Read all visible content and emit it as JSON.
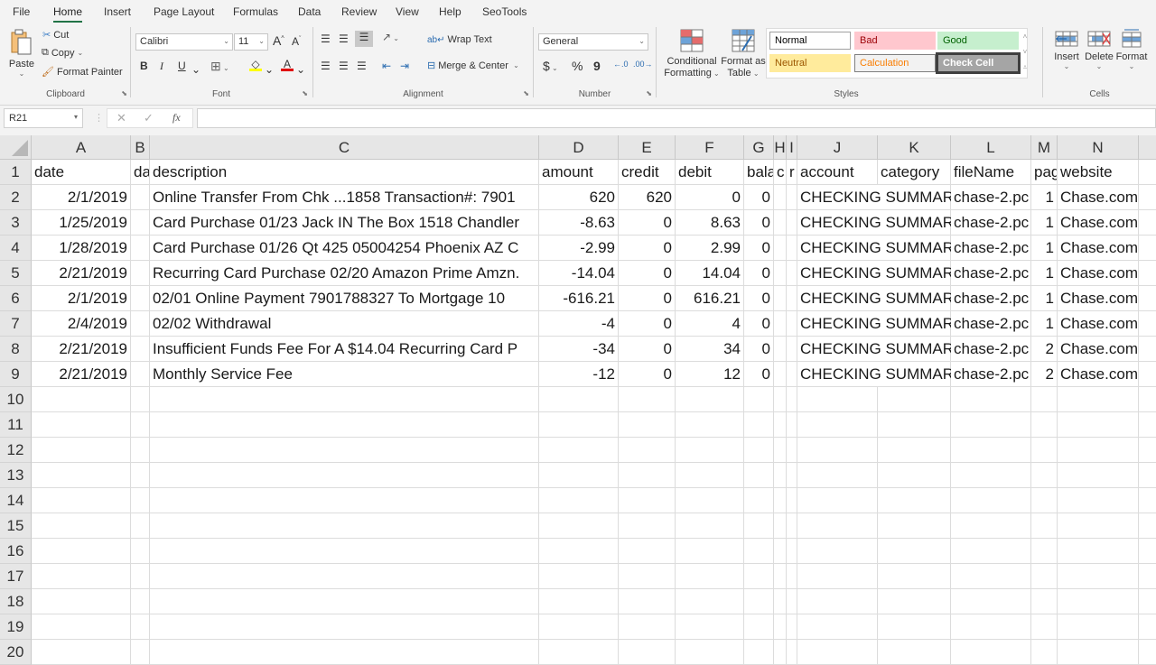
{
  "ribbon": {
    "tabs": [
      "File",
      "Home",
      "Insert",
      "Page Layout",
      "Formulas",
      "Data",
      "Review",
      "View",
      "Help",
      "SeoTools"
    ],
    "active_tab": "Home",
    "clipboard": {
      "paste": "Paste",
      "cut": "Cut",
      "copy": "Copy",
      "format_painter": "Format Painter",
      "label": "Clipboard"
    },
    "font": {
      "name": "Calibri",
      "size": "11",
      "label": "Font",
      "bold": "B",
      "italic": "I",
      "underline": "U",
      "fill_color": "#ffff00",
      "font_color": "#e00000"
    },
    "alignment": {
      "wrap_text": "Wrap Text",
      "merge_center": "Merge & Center",
      "label": "Alignment"
    },
    "number": {
      "format": "General",
      "label": "Number",
      "currency": "$",
      "percent": "%",
      "comma": "9"
    },
    "styles": {
      "conditional_formatting": [
        "Conditional",
        "Formatting"
      ],
      "format_as_table": [
        "Format as",
        "Table"
      ],
      "cells": [
        {
          "label": "Normal",
          "bg": "#ffffff",
          "color": "#000000",
          "border": "#a0a0a0"
        },
        {
          "label": "Bad",
          "bg": "#ffc7ce",
          "color": "#9c0006",
          "border": "#ffc7ce"
        },
        {
          "label": "Good",
          "bg": "#c6efce",
          "color": "#006100",
          "border": "#c6efce"
        },
        {
          "label": "Neutral",
          "bg": "#ffeb9c",
          "color": "#9c5700",
          "border": "#ffeb9c"
        },
        {
          "label": "Calculation",
          "bg": "#f2f2f2",
          "color": "#fa7d00",
          "border": "#7f7f7f"
        },
        {
          "label": "Check Cell",
          "bg": "#a5a5a5",
          "color": "#ffffff",
          "border": "#3f3f3f"
        }
      ],
      "label": "Styles"
    },
    "cells": {
      "insert": "Insert",
      "delete": "Delete",
      "format": "Format",
      "label": "Cells"
    }
  },
  "formula_bar": {
    "name_box": "R21",
    "fx": "fx",
    "value": ""
  },
  "sheet": {
    "columns": [
      "A",
      "B",
      "C",
      "D",
      "E",
      "F",
      "G",
      "H",
      "I",
      "J",
      "K",
      "L",
      "M",
      "N"
    ],
    "row_numbers": [
      "1",
      "2",
      "3",
      "4",
      "5",
      "6",
      "7",
      "8",
      "9",
      "10",
      "11",
      "12",
      "13",
      "14",
      "15",
      "16",
      "17",
      "18",
      "19",
      "20"
    ],
    "header": [
      "date",
      "da",
      "description",
      "amount",
      "credit",
      "debit",
      "bala",
      "c",
      "r",
      "account",
      "category",
      "fileName",
      "pag",
      "website"
    ],
    "rows": [
      [
        "2/1/2019",
        "",
        "Online Transfer From Chk ...1858 Transaction#: 7901",
        "620",
        "620",
        "0",
        "0",
        "",
        "",
        "CHECKING SUMMAR",
        "",
        "chase-2.pc",
        "1",
        "Chase.com"
      ],
      [
        "1/25/2019",
        "",
        "Card Purchase 01/23 Jack IN The Box 1518 Chandler",
        "-8.63",
        "0",
        "8.63",
        "0",
        "",
        "",
        "CHECKING SUMMAR",
        "",
        "chase-2.pc",
        "1",
        "Chase.com"
      ],
      [
        "1/28/2019",
        "",
        "Card Purchase 01/26 Qt 425 05004254 Phoenix AZ C",
        "-2.99",
        "0",
        "2.99",
        "0",
        "",
        "",
        "CHECKING SUMMAR",
        "",
        "chase-2.pc",
        "1",
        "Chase.com"
      ],
      [
        "2/21/2019",
        "",
        "Recurring Card Purchase 02/20 Amazon Prime Amzn.",
        "-14.04",
        "0",
        "14.04",
        "0",
        "",
        "",
        "CHECKING SUMMAR",
        "",
        "chase-2.pc",
        "1",
        "Chase.com"
      ],
      [
        "2/1/2019",
        "",
        "02/01 Online Payment 7901788327 To Mortgage 10",
        "-616.21",
        "0",
        "616.21",
        "0",
        "",
        "",
        "CHECKING SUMMAR",
        "",
        "chase-2.pc",
        "1",
        "Chase.com"
      ],
      [
        "2/4/2019",
        "",
        "02/02 Withdrawal",
        "-4",
        "0",
        "4",
        "0",
        "",
        "",
        "CHECKING SUMMAR",
        "",
        "chase-2.pc",
        "1",
        "Chase.com"
      ],
      [
        "2/21/2019",
        "",
        "Insufficient Funds Fee For A $14.04 Recurring Card P",
        "-34",
        "0",
        "34",
        "0",
        "",
        "",
        "CHECKING SUMMAR",
        "",
        "chase-2.pc",
        "2",
        "Chase.com"
      ],
      [
        "2/21/2019",
        "",
        "Monthly Service Fee",
        "-12",
        "0",
        "12",
        "0",
        "",
        "",
        "CHECKING SUMMAR",
        "",
        "chase-2.pc",
        "2",
        "Chase.com"
      ]
    ]
  }
}
